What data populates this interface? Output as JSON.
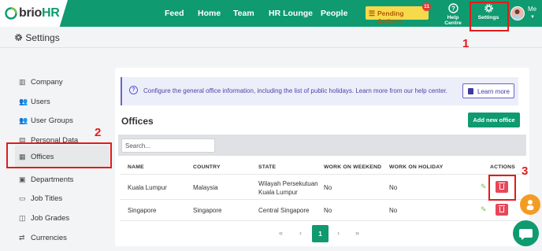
{
  "brand": {
    "name_prefix": "brio",
    "name_suffix": "HR"
  },
  "nav": {
    "links": [
      "Feed",
      "Home",
      "Team",
      "HR Lounge",
      "People"
    ],
    "pending_label": "Pending Actions",
    "pending_count": "11",
    "help_label": "Help Centre",
    "settings_label": "Settings",
    "user_label": "Me"
  },
  "page": {
    "title": "Settings"
  },
  "sidebar": {
    "items": [
      {
        "label": "Company",
        "icon": "building-icon"
      },
      {
        "label": "Users",
        "icon": "users-icon"
      },
      {
        "label": "User Groups",
        "icon": "user-groups-icon"
      },
      {
        "label": "Personal Data",
        "icon": "id-card-icon"
      },
      {
        "label": "Offices",
        "icon": "office-icon",
        "active": true
      },
      {
        "label": "Departments",
        "icon": "departments-icon"
      },
      {
        "label": "Job Titles",
        "icon": "briefcase-icon"
      },
      {
        "label": "Job Grades",
        "icon": "grade-icon"
      },
      {
        "label": "Currencies",
        "icon": "exchange-icon"
      }
    ]
  },
  "info_banner": {
    "text": "Configure the general office information, including the list of public holidays. Learn more from our help center.",
    "button_label": "Learn more"
  },
  "offices": {
    "title": "Offices",
    "add_label": "Add new office",
    "search_placeholder": "Search...",
    "columns": [
      "NAME",
      "COUNTRY",
      "STATE",
      "WORK ON WEEKEND",
      "WORK ON HOLIDAY",
      "ACTIONS"
    ],
    "rows": [
      {
        "name": "Kuala Lumpur",
        "country": "Malaysia",
        "state_line1": "Wilayah Persekutuan",
        "state_line2": "Kuala Lumpur",
        "weekend": "No",
        "holiday": "No"
      },
      {
        "name": "Singapore",
        "country": "Singapore",
        "state_line1": "Central Singapore",
        "state_line2": "",
        "weekend": "No",
        "holiday": "No"
      }
    ]
  },
  "pagination": {
    "first": "«",
    "prev": "‹",
    "current": "1",
    "next": "›",
    "last": "»"
  },
  "annotations": [
    "1",
    "2",
    "3"
  ],
  "colors": {
    "brand_green": "#109a6f",
    "annotation_red": "#e21b1b",
    "pending_yellow": "#f7d94c",
    "delete_red": "#e8475a"
  }
}
